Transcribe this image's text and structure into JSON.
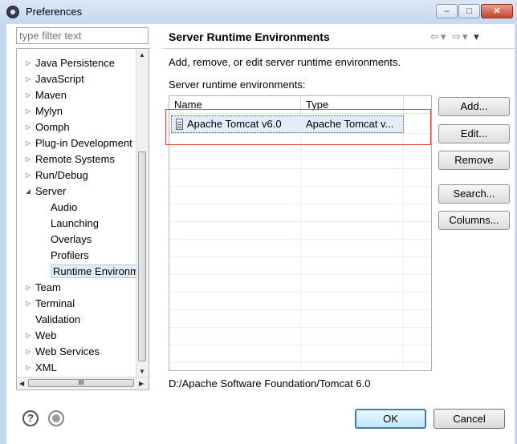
{
  "window": {
    "title": "Preferences",
    "minimize": "–",
    "maximize": "□",
    "close": "✕"
  },
  "filter": {
    "placeholder": "type filter text"
  },
  "tree": {
    "items": [
      {
        "label": "Java Persistence",
        "twisty": "▷",
        "level": 0
      },
      {
        "label": "JavaScript",
        "twisty": "▷",
        "level": 0
      },
      {
        "label": "Maven",
        "twisty": "▷",
        "level": 0
      },
      {
        "label": "Mylyn",
        "twisty": "▷",
        "level": 0
      },
      {
        "label": "Oomph",
        "twisty": "▷",
        "level": 0
      },
      {
        "label": "Plug-in Development",
        "twisty": "▷",
        "level": 0
      },
      {
        "label": "Remote Systems",
        "twisty": "▷",
        "level": 0
      },
      {
        "label": "Run/Debug",
        "twisty": "▷",
        "level": 0
      },
      {
        "label": "Server",
        "twisty": "◢",
        "level": 0
      },
      {
        "label": "Audio",
        "twisty": "",
        "level": 1
      },
      {
        "label": "Launching",
        "twisty": "",
        "level": 1
      },
      {
        "label": "Overlays",
        "twisty": "",
        "level": 1
      },
      {
        "label": "Profilers",
        "twisty": "",
        "level": 1
      },
      {
        "label": "Runtime Environm",
        "twisty": "",
        "level": 1,
        "selected": true
      },
      {
        "label": "Team",
        "twisty": "▷",
        "level": 0
      },
      {
        "label": "Terminal",
        "twisty": "▷",
        "level": 0
      },
      {
        "label": "Validation",
        "twisty": "",
        "level": 0
      },
      {
        "label": "Web",
        "twisty": "▷",
        "level": 0
      },
      {
        "label": "Web Services",
        "twisty": "▷",
        "level": 0
      },
      {
        "label": "XML",
        "twisty": "▷",
        "level": 0
      }
    ]
  },
  "page": {
    "title": "Server Runtime Environments",
    "description": "Add, remove, or edit server runtime environments.",
    "table_label": "Server runtime environments:",
    "columns": [
      "Name",
      "Type"
    ],
    "rows": [
      {
        "name": "Apache Tomcat v6.0",
        "type": "Apache Tomcat v..."
      }
    ],
    "path": "D:/Apache Software Foundation/Tomcat 6.0"
  },
  "buttons": {
    "add": "Add...",
    "edit": "Edit...",
    "remove": "Remove",
    "search": "Search...",
    "columns": "Columns..."
  },
  "nav": {
    "back": "⇦",
    "forward": "⇨",
    "menu": "▾"
  },
  "dialog": {
    "ok": "OK",
    "cancel": "Cancel",
    "help": "?"
  },
  "colors": {
    "highlight": "#e04040",
    "selection": "#e3edf9",
    "titlebar": "#c6d8ef"
  }
}
